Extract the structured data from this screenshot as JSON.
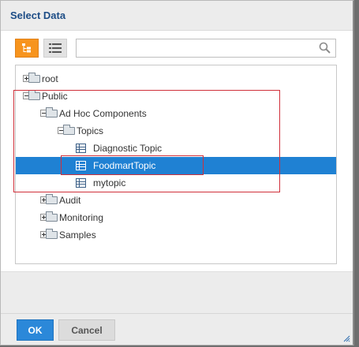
{
  "dialog": {
    "title": "Select Data"
  },
  "toolbar": {
    "tree_view_icon": "tree-view-icon",
    "list_view_icon": "list-view-icon",
    "search": {
      "value": "",
      "placeholder": ""
    }
  },
  "tree": {
    "nodes": [
      {
        "label": "root",
        "type": "folder",
        "state": "collapsed"
      },
      {
        "label": "Public",
        "type": "folder",
        "state": "expanded"
      },
      {
        "label": "Ad Hoc Components",
        "type": "folder",
        "state": "expanded"
      },
      {
        "label": "Topics",
        "type": "folder",
        "state": "expanded"
      },
      {
        "label": "Diagnostic Topic",
        "type": "topic"
      },
      {
        "label": "FoodmartTopic",
        "type": "topic",
        "selected": true
      },
      {
        "label": "mytopic",
        "type": "topic"
      },
      {
        "label": "Audit",
        "type": "folder",
        "state": "collapsed"
      },
      {
        "label": "Monitoring",
        "type": "folder",
        "state": "collapsed"
      },
      {
        "label": "Samples",
        "type": "folder",
        "state": "collapsed"
      }
    ]
  },
  "footer": {
    "ok_label": "OK",
    "cancel_label": "Cancel"
  },
  "colors": {
    "title": "#1d4d86",
    "accent": "#f7941d",
    "selection": "#1f81d3",
    "highlight_border": "#d0303a"
  }
}
